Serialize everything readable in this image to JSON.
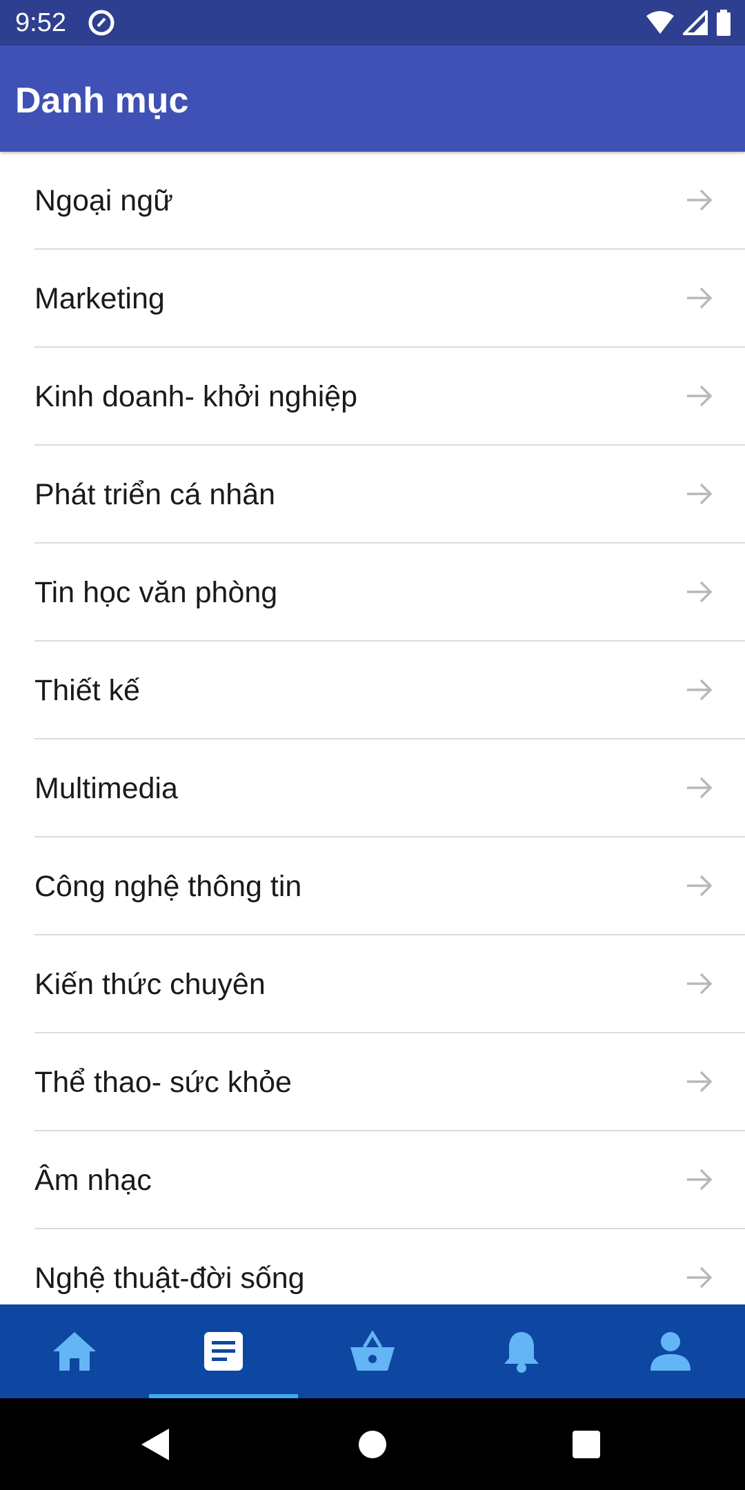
{
  "status_bar": {
    "time": "9:52",
    "icons": [
      "app-notification-icon",
      "wifi-icon",
      "signal-icon",
      "battery-icon"
    ]
  },
  "app_bar": {
    "title": "Danh mục",
    "background": "#3f51b5"
  },
  "categories": [
    {
      "label": "Ngoại ngữ"
    },
    {
      "label": "Marketing"
    },
    {
      "label": "Kinh doanh- khởi nghiệp"
    },
    {
      "label": "Phát triển cá nhân"
    },
    {
      "label": "Tin học văn phòng"
    },
    {
      "label": "Thiết kế"
    },
    {
      "label": "Multimedia"
    },
    {
      "label": "Công nghệ thông tin"
    },
    {
      "label": "Kiến thức chuyên"
    },
    {
      "label": "Thể thao- sức khỏe"
    },
    {
      "label": "Âm nhạc"
    },
    {
      "label": "Nghệ thuật-đời sống"
    }
  ],
  "bottom_nav": {
    "background": "#0d47a1",
    "icon_color": "#64b5f6",
    "active_color": "#ffffff",
    "items": [
      {
        "icon": "home-icon",
        "active": false
      },
      {
        "icon": "document-icon",
        "active": true
      },
      {
        "icon": "basket-icon",
        "active": false
      },
      {
        "icon": "bell-icon",
        "active": false
      },
      {
        "icon": "person-icon",
        "active": false
      }
    ]
  },
  "system_nav": {
    "buttons": [
      "back-icon",
      "home-circle-icon",
      "recents-icon"
    ]
  }
}
